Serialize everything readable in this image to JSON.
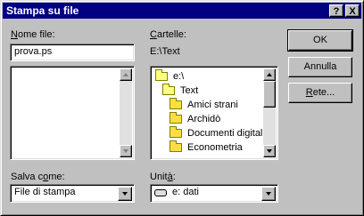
{
  "window": {
    "title": "Stampa su file"
  },
  "titlebar_buttons": {
    "help": "?",
    "close": "X"
  },
  "filename": {
    "label_pre": "N",
    "label_rest": "ome file:",
    "value": "prova.ps"
  },
  "folders": {
    "label_pre": "C",
    "label_rest": "artelle:",
    "path": "E:\\Text",
    "items": [
      "e:\\",
      "Text",
      "Amici strani",
      "Archidò",
      "Documenti digitalizz",
      "Econometria"
    ]
  },
  "save_as": {
    "label_pre": "Salva c",
    "label_u": "o",
    "label_rest": "me:",
    "value": "File di stampa"
  },
  "drive": {
    "label_pre": "Unit",
    "label_u": "à",
    "label_rest": ":",
    "value": "e: dati"
  },
  "buttons": {
    "ok": "OK",
    "cancel": "Annulla",
    "network_pre": "R",
    "network_rest": "ete..."
  }
}
